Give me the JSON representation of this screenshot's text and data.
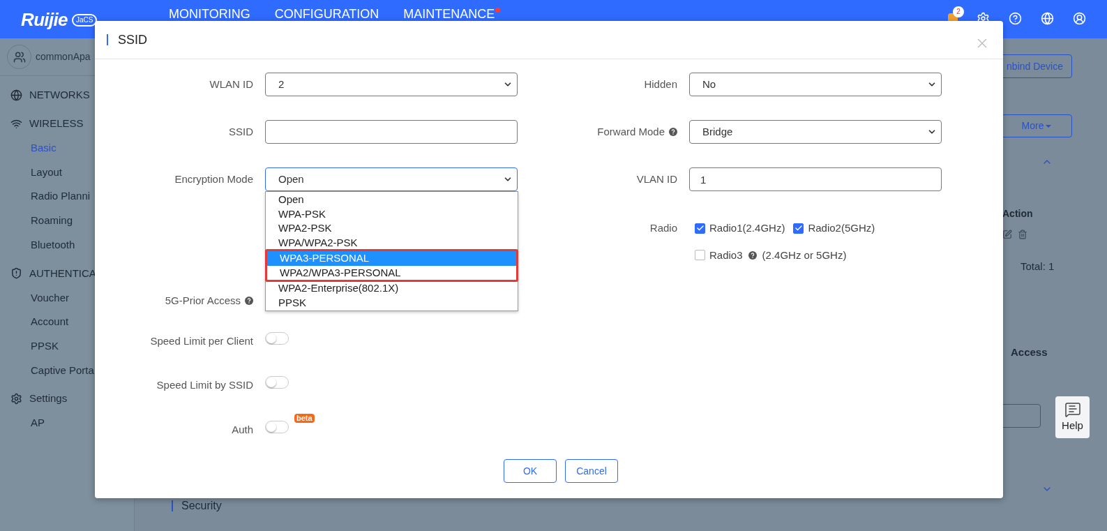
{
  "header": {
    "logo": {
      "brand": "Ruijie",
      "badge": "JaCS"
    },
    "nav": [
      {
        "label": "MONITORING",
        "alert": false
      },
      {
        "label": "CONFIGURATION",
        "alert": false
      },
      {
        "label": "MAINTENANCE",
        "alert": true
      }
    ],
    "notifications": "2"
  },
  "sidebar": {
    "user": "commonApa",
    "groups": [
      {
        "kind": "globe",
        "label": "NETWORKS"
      },
      {
        "kind": "wifi",
        "label": "WIRELESS",
        "items": [
          {
            "label": "Basic",
            "selected": true
          },
          {
            "label": "Layout",
            "selected": false
          },
          {
            "label": "Radio Planni",
            "selected": false
          },
          {
            "label": "Roaming",
            "selected": false
          },
          {
            "label": "Bluetooth",
            "selected": false
          }
        ]
      },
      {
        "kind": "shield",
        "label": "AUTHENTICA",
        "items": [
          {
            "label": "Voucher",
            "selected": false
          },
          {
            "label": "Account",
            "selected": false
          },
          {
            "label": "PPSK",
            "selected": false
          },
          {
            "label": "Captive Porta",
            "selected": false
          }
        ]
      },
      {
        "kind": "gear",
        "label": "Settings",
        "items": [
          {
            "label": "AP",
            "selected": false
          }
        ]
      }
    ]
  },
  "page": {
    "unbind_button": "nbind Device",
    "more_button": "More",
    "table_header": "Action",
    "total": "Total: 1",
    "access_label": "Access",
    "section": "Security"
  },
  "help_button": "Help",
  "dialog": {
    "title": "SSID",
    "left": [
      {
        "kind": "select",
        "label": "WLAN ID",
        "value": "2",
        "focused": false,
        "info": false
      },
      {
        "kind": "input",
        "label": "SSID",
        "focused": false,
        "info": false
      },
      {
        "kind": "select",
        "label": "Encryption Mode",
        "value": "Open",
        "focused": true,
        "info": false
      },
      {
        "kind": "covered",
        "label": "5G-Prior Access",
        "info": true
      },
      {
        "kind": "toggle",
        "label": "Speed Limit per Client",
        "on": false,
        "info": false
      },
      {
        "kind": "toggle",
        "label": "Speed Limit by SSID",
        "on": false,
        "info": false
      },
      {
        "kind": "toggle",
        "label": "Auth",
        "on": false,
        "info": false,
        "badge": "beta"
      }
    ],
    "right": [
      {
        "kind": "select",
        "label": "Hidden",
        "value": "No",
        "info": false
      },
      {
        "kind": "select",
        "label": "Forward Mode",
        "value": "Bridge",
        "info": true
      },
      {
        "kind": "input",
        "label": "VLAN ID",
        "value": "1",
        "info": false
      }
    ],
    "radio": {
      "label": "Radio",
      "options": [
        {
          "label": "Radio1(2.4GHz)",
          "checked": true,
          "info": false
        },
        {
          "label": "Radio2(5GHz)",
          "checked": true,
          "info": false
        },
        {
          "label": "Radio3",
          "checked": false,
          "info": true,
          "note": "(2.4GHz or 5GHz)"
        }
      ]
    },
    "dropdown": [
      {
        "label": "Open",
        "selected": false,
        "highlighted": false
      },
      {
        "label": "WPA-PSK",
        "selected": false,
        "highlighted": false
      },
      {
        "label": "WPA2-PSK",
        "selected": false,
        "highlighted": false
      },
      {
        "label": "WPA/WPA2-PSK",
        "selected": false,
        "highlighted": false
      },
      {
        "label": "WPA3-PERSONAL",
        "selected": true,
        "highlighted": true
      },
      {
        "label": "WPA2/WPA3-PERSONAL",
        "selected": false,
        "highlighted": true
      },
      {
        "label": "WPA2-Enterprise(802.1X)",
        "selected": false,
        "highlighted": false
      },
      {
        "label": "PPSK",
        "selected": false,
        "highlighted": false
      }
    ],
    "buttons": [
      {
        "label": "OK"
      },
      {
        "label": "Cancel"
      }
    ]
  }
}
